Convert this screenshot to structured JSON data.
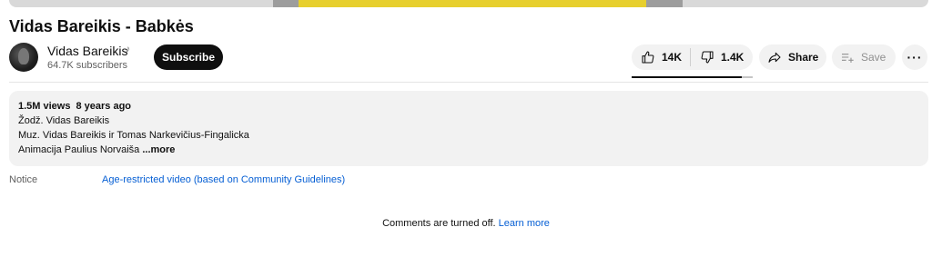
{
  "video": {
    "title": "Vidas Bareikis - Babkės"
  },
  "channel": {
    "name": "Vidas Bareikis",
    "subscribers": "64.7K subscribers",
    "subscribe_label": "Subscribe"
  },
  "actions": {
    "likes": "14K",
    "dislikes": "1.4K",
    "share_label": "Share",
    "save_label": "Save",
    "like_ratio": 0.91
  },
  "description": {
    "views": "1.5M views",
    "age": "8 years ago",
    "lines": [
      "Žodž. Vidas Bareikis",
      "Muz. Vidas Bareikis ir Tomas Narkevičius-Fingalicka",
      "Animacija Paulius Norvaiša"
    ],
    "more_label": "...more"
  },
  "notice": {
    "label": "Notice",
    "text": "Age-restricted video (based on Community Guidelines)"
  },
  "comments": {
    "text": "Comments are turned off.",
    "learn_more": "Learn more"
  },
  "colors": {
    "accent_link": "#065fd4",
    "button_bg": "#f2f2f2",
    "subscribe_bg": "#0f0f0f"
  }
}
